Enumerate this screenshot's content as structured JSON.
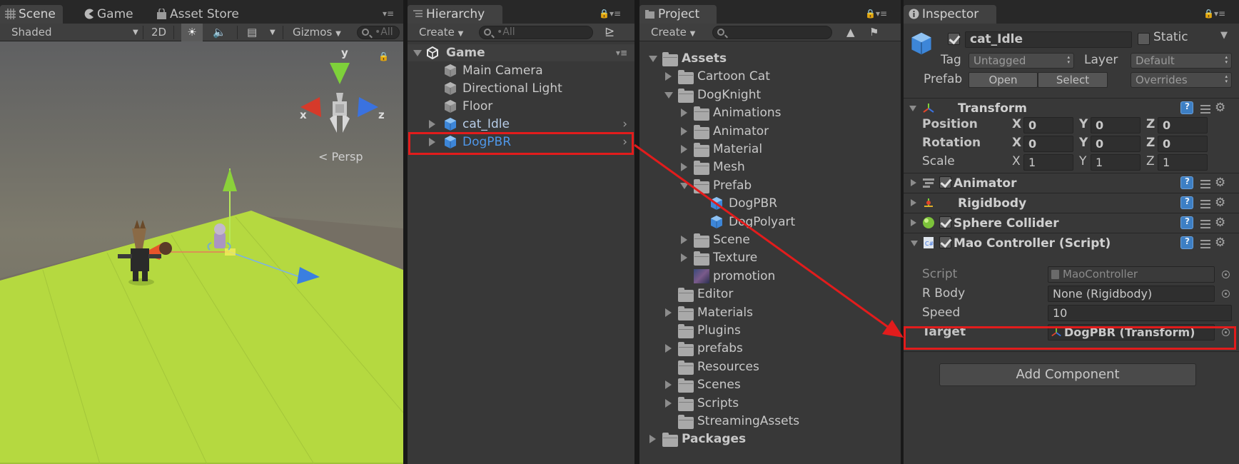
{
  "scene_panel": {
    "tabs": [
      {
        "label": "Scene",
        "icon": "grid-icon"
      },
      {
        "label": "Game",
        "icon": "pacman-icon"
      },
      {
        "label": "Asset Store",
        "icon": "store-bag-icon"
      }
    ],
    "toolbar": {
      "shading_mode": "Shaded",
      "mode_2d": "2D",
      "gizmos": "Gizmos",
      "search_placeholder": "•All"
    },
    "gizmo": {
      "x": "x",
      "y": "y",
      "z": "z",
      "projection": "Persp"
    },
    "colors": {
      "floor": "#b5d940",
      "sky_top": "#5a5a5a",
      "horizon": "#7a7a6e"
    }
  },
  "hierarchy_panel": {
    "tab": "Hierarchy",
    "create_label": "Create",
    "search_placeholder": "•All",
    "scene_name": "Game",
    "items": [
      {
        "label": "Main Camera",
        "type": "gameobject"
      },
      {
        "label": "Directional Light",
        "type": "gameobject"
      },
      {
        "label": "Floor",
        "type": "gameobject"
      },
      {
        "label": "cat_Idle",
        "type": "prefab"
      },
      {
        "label": "DogPBR",
        "type": "prefab"
      }
    ]
  },
  "project_panel": {
    "tab": "Project",
    "create_label": "Create",
    "tree": [
      {
        "label": "Assets",
        "depth": 0,
        "expanded": true,
        "bold": true,
        "kind": "folder"
      },
      {
        "label": "Cartoon Cat",
        "depth": 1,
        "expanded": false,
        "kind": "folder"
      },
      {
        "label": "DogKnight",
        "depth": 1,
        "expanded": true,
        "kind": "folder"
      },
      {
        "label": "Animations",
        "depth": 2,
        "expanded": false,
        "kind": "folder"
      },
      {
        "label": "Animator",
        "depth": 2,
        "expanded": false,
        "kind": "folder"
      },
      {
        "label": "Material",
        "depth": 2,
        "expanded": false,
        "kind": "folder"
      },
      {
        "label": "Mesh",
        "depth": 2,
        "expanded": false,
        "kind": "folder"
      },
      {
        "label": "Prefab",
        "depth": 2,
        "expanded": true,
        "kind": "folder"
      },
      {
        "label": "DogPBR",
        "depth": 3,
        "kind": "prefab"
      },
      {
        "label": "DogPolyart",
        "depth": 3,
        "kind": "prefab"
      },
      {
        "label": "Scene",
        "depth": 2,
        "expanded": false,
        "kind": "folder"
      },
      {
        "label": "Texture",
        "depth": 2,
        "expanded": false,
        "kind": "folder"
      },
      {
        "label": "promotion",
        "depth": 2,
        "kind": "image"
      },
      {
        "label": "Editor",
        "depth": 1,
        "kind": "folder-leaf"
      },
      {
        "label": "Materials",
        "depth": 1,
        "expanded": false,
        "kind": "folder"
      },
      {
        "label": "Plugins",
        "depth": 1,
        "kind": "folder-leaf"
      },
      {
        "label": "prefabs",
        "depth": 1,
        "expanded": false,
        "kind": "folder"
      },
      {
        "label": "Resources",
        "depth": 1,
        "kind": "folder-leaf"
      },
      {
        "label": "Scenes",
        "depth": 1,
        "expanded": false,
        "kind": "folder"
      },
      {
        "label": "Scripts",
        "depth": 1,
        "expanded": false,
        "kind": "folder"
      },
      {
        "label": "StreamingAssets",
        "depth": 1,
        "kind": "folder-leaf"
      },
      {
        "label": "Packages",
        "depth": 0,
        "expanded": false,
        "bold": true,
        "kind": "folder"
      }
    ]
  },
  "inspector_panel": {
    "tab": "Inspector",
    "object_name": "cat_Idle",
    "static_label": "Static",
    "tag_label": "Tag",
    "tag_value": "Untagged",
    "layer_label": "Layer",
    "layer_value": "Default",
    "prefab_label": "Prefab",
    "open_label": "Open",
    "select_label": "Select",
    "overrides_label": "Overrides",
    "transform": {
      "title": "Transform",
      "rows": [
        {
          "label": "Position",
          "x": "0",
          "y": "0",
          "z": "0",
          "bold": true
        },
        {
          "label": "Rotation",
          "x": "0",
          "y": "0",
          "z": "0",
          "bold": true
        },
        {
          "label": "Scale",
          "x": "1",
          "y": "1",
          "z": "1",
          "bold": false
        }
      ],
      "axis_x": "X",
      "axis_y": "Y",
      "axis_z": "Z"
    },
    "components": [
      {
        "title": "Animator",
        "checkbox": true
      },
      {
        "title": "Rigidbody",
        "checkbox": false
      },
      {
        "title": "Sphere Collider",
        "checkbox": true
      },
      {
        "title": "Mao Controller (Script)",
        "checkbox": true
      }
    ],
    "script_fields": {
      "script_label": "Script",
      "script_value": "MaoController",
      "rbody_label": "R Body",
      "rbody_value": "None (Rigidbody)",
      "speed_label": "Speed",
      "speed_value": "10",
      "target_label": "Target",
      "target_value": "DogPBR (Transform)"
    },
    "add_component": "Add Component"
  },
  "annotation_color": "#e21c1c"
}
